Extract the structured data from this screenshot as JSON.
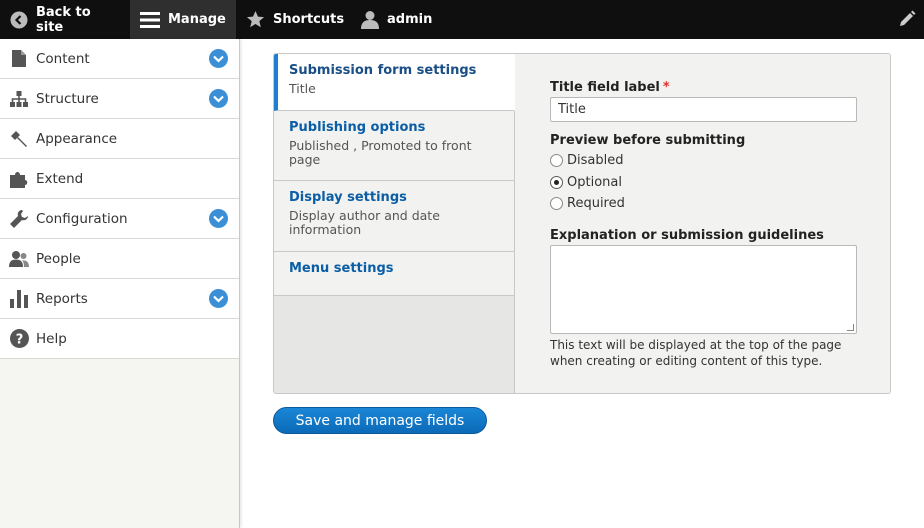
{
  "toolbar": {
    "back_label": "Back to site",
    "manage_label": "Manage",
    "shortcuts_label": "Shortcuts",
    "user_label": "admin"
  },
  "sidebar": {
    "items": [
      {
        "label": "Content",
        "icon": "content-icon",
        "expandable": true
      },
      {
        "label": "Structure",
        "icon": "structure-icon",
        "expandable": true
      },
      {
        "label": "Appearance",
        "icon": "appearance-icon",
        "expandable": false
      },
      {
        "label": "Extend",
        "icon": "extend-icon",
        "expandable": false
      },
      {
        "label": "Configuration",
        "icon": "wrench-icon",
        "expandable": true
      },
      {
        "label": "People",
        "icon": "people-icon",
        "expandable": false
      },
      {
        "label": "Reports",
        "icon": "reports-icon",
        "expandable": true
      },
      {
        "label": "Help",
        "icon": "help-icon",
        "expandable": false
      }
    ]
  },
  "tabs": [
    {
      "title": "Submission form settings",
      "summary": "Title",
      "active": true
    },
    {
      "title": "Publishing options",
      "summary": "Published , Promoted to front page",
      "active": false
    },
    {
      "title": "Display settings",
      "summary": "Display author and date information",
      "active": false
    },
    {
      "title": "Menu settings",
      "summary": "",
      "active": false
    }
  ],
  "form": {
    "title_field_label": "Title field label",
    "required_marker": "*",
    "title_field_value": "Title",
    "preview_label": "Preview before submitting",
    "preview_options": [
      {
        "label": "Disabled",
        "checked": false
      },
      {
        "label": "Optional",
        "checked": true
      },
      {
        "label": "Required",
        "checked": false
      }
    ],
    "explanation_label": "Explanation or submission guidelines",
    "explanation_value": "",
    "explanation_help": "This text will be displayed at the top of the page when creating or editing content of this type."
  },
  "actions": {
    "save_label": "Save and manage fields"
  },
  "colors": {
    "accent": "#1e7fd1",
    "link": "#0b5ea6",
    "toolbar_bg": "#0f0f0f",
    "required": "#e52d2d"
  }
}
